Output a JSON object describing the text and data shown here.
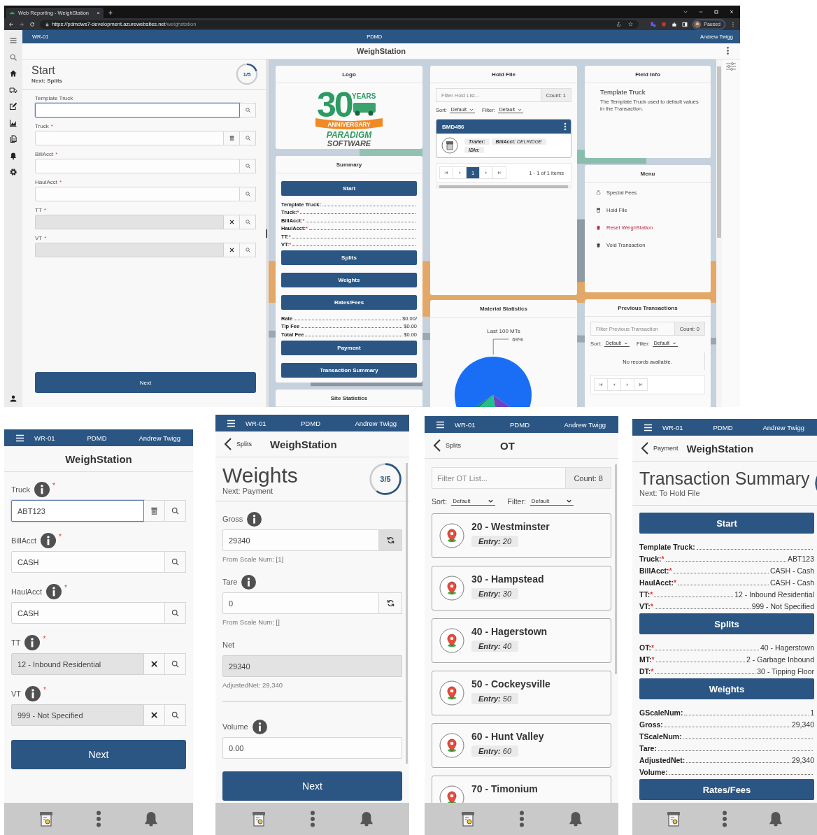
{
  "browser": {
    "tab_title": "Web Reporting - WeighStation",
    "tab_close": "×",
    "new_tab": "+",
    "url_host": "https://pdmdws7-development.azurewebsites.net",
    "url_path": "/weighstation",
    "profile_status": "Paused"
  },
  "desktop": {
    "header": {
      "station": "WR-01",
      "site": "PDMD",
      "user": "Andrew Twigg"
    },
    "title": "WeighStation",
    "step": {
      "title": "Start",
      "next": "Next: Splits",
      "progress": "1/5"
    },
    "fields": [
      {
        "label": "Template Truck",
        "focused": true,
        "disabled": false,
        "actions": [
          {
            "kind": "search"
          }
        ]
      },
      {
        "label": "Truck",
        "required_mark": "*",
        "focused": false,
        "disabled": false,
        "actions": [
          {
            "kind": "hold"
          },
          {
            "kind": "search"
          }
        ]
      },
      {
        "label": "BillAcct",
        "required_mark": "*",
        "focused": false,
        "disabled": false,
        "actions": [
          {
            "kind": "search"
          }
        ]
      },
      {
        "label": "HaulAcct",
        "required_mark": "*",
        "focused": false,
        "disabled": false,
        "actions": [
          {
            "kind": "search"
          }
        ]
      },
      {
        "label": "TT",
        "required_mark": "*",
        "focused": false,
        "disabled": true,
        "actions": [
          {
            "kind": "clear"
          },
          {
            "kind": "search"
          }
        ]
      },
      {
        "label": "VT",
        "required_mark": "*",
        "focused": false,
        "disabled": true,
        "actions": [
          {
            "kind": "clear"
          },
          {
            "kind": "search"
          }
        ]
      }
    ],
    "next_button": "Next",
    "columns": [
      [
        {
          "kind": "logo",
          "title": "Logo",
          "logo": {
            "number": "30",
            "badge": "YEARS",
            "ribbon": "ANNIVERSARY",
            "name": "PARADIGM",
            "tagline": "SOFTWARE"
          }
        },
        {
          "kind": "summary",
          "title": "Summary",
          "items": [
            {
              "kind": "button",
              "label": "Start"
            },
            {
              "kind": "row",
              "label": "Template Truck:"
            },
            {
              "kind": "row",
              "label": "Truck:",
              "mark": "*"
            },
            {
              "kind": "row",
              "label": "BillAcct:",
              "mark": "*"
            },
            {
              "kind": "row",
              "label": "HaulAcct:",
              "mark": "*"
            },
            {
              "kind": "row",
              "label": "TT:",
              "mark": "*"
            },
            {
              "kind": "row",
              "label": "VT:",
              "mark": "*"
            },
            {
              "kind": "button",
              "label": "Splits"
            },
            {
              "kind": "button",
              "label": "Weights"
            },
            {
              "kind": "button",
              "label": "Rates/Fees"
            },
            {
              "kind": "row",
              "label": "Rate",
              "value": "$0.00/"
            },
            {
              "kind": "row",
              "label": "Tip Fee",
              "value": "$0.00"
            },
            {
              "kind": "row",
              "label": "Total Fee",
              "value": "$0.00"
            },
            {
              "kind": "button",
              "label": "Payment"
            },
            {
              "kind": "button",
              "label": "Transaction Summary"
            }
          ]
        },
        {
          "kind": "plain",
          "title": "Site Statistics"
        }
      ],
      [
        {
          "kind": "hold_file",
          "title": "Hold File",
          "filter_placeholder": "Filter Hold List...",
          "count": "Count: 1",
          "sort_label": "Sort:",
          "sort_value": "Default",
          "filter_label": "Filter:",
          "filter_value": "Default",
          "cards": [
            {
              "name": "BMD456",
              "tags": [
                {
                  "label": "Trailer:"
                },
                {
                  "label": "BillAcct:",
                  "value": "DELRIDGE"
                },
                {
                  "label": "IDIn:"
                }
              ]
            }
          ],
          "pages": [
            {
              "label": "1",
              "selected": true
            }
          ],
          "pager_summary": "1 - 1 of 1 items"
        },
        {
          "kind": "material_stats",
          "title": "Material Statistics",
          "chart_data": {
            "type": "pie",
            "title": "Last 100 MTs",
            "values": [
              69,
              13,
              16,
              2
            ],
            "colors": [
              "#1a6ef5",
              "#6f42c1",
              "#20c08a",
              "#198754"
            ],
            "value_labels": [
              "69%",
              null,
              null,
              null
            ]
          }
        }
      ],
      [
        {
          "kind": "field_info",
          "title": "Field Info",
          "heading": "Template Truck",
          "text": "The Template Truck used to default values in the Transaction."
        },
        {
          "kind": "menu",
          "title": "Menu",
          "items": [
            {
              "kind": "fees",
              "label": "Special Fees",
              "danger": false
            },
            {
              "kind": "hold",
              "label": "Hold File",
              "danger": false
            },
            {
              "kind": "trash",
              "label": "Reset WeighStation",
              "danger": true
            },
            {
              "kind": "trash",
              "label": "Void Transaction",
              "danger": false
            }
          ]
        },
        {
          "kind": "previous_transactions",
          "title": "Previous Transactions",
          "filter_placeholder": "Filter Previous Transaction",
          "count": "Count: 0",
          "sort_label": "Sort:",
          "sort_value": "Default",
          "filter_label": "Filter:",
          "filter_value": "Default",
          "empty_text": "No records available."
        }
      ]
    ]
  },
  "phones": [
    {
      "kind": "form",
      "header": {
        "station": "WR-01",
        "site": "PDMD",
        "user": "Andrew Twigg"
      },
      "title": "WeighStation",
      "fields": [
        {
          "kind": "field",
          "label": "Truck",
          "info": true,
          "required_mark": "*",
          "value": "ABT123",
          "focused": true,
          "disabled": false,
          "actions": [
            {
              "kind": "hold"
            },
            {
              "kind": "search"
            }
          ]
        },
        {
          "kind": "field",
          "label": "BillAcct",
          "info": true,
          "required_mark": "*",
          "value": "CASH",
          "focused": false,
          "disabled": false,
          "actions": [
            {
              "kind": "search"
            }
          ]
        },
        {
          "kind": "field",
          "label": "HaulAcct",
          "info": true,
          "required_mark": "*",
          "value": "CASH",
          "focused": false,
          "disabled": false,
          "actions": [
            {
              "kind": "search"
            }
          ]
        },
        {
          "kind": "field",
          "label": "TT",
          "info": true,
          "required_mark": "*",
          "value": "12 - Inbound Residential",
          "focused": false,
          "disabled": true,
          "actions": [
            {
              "kind": "clear"
            },
            {
              "kind": "search"
            }
          ]
        },
        {
          "kind": "field",
          "label": "VT",
          "info": true,
          "required_mark": "*",
          "value": "999 - Not Specified",
          "focused": false,
          "disabled": true,
          "actions": [
            {
              "kind": "clear"
            },
            {
              "kind": "search"
            }
          ]
        }
      ],
      "next_button": "Next"
    },
    {
      "kind": "weights",
      "header": {
        "station": "WR-01",
        "site": "PDMD",
        "user": "Andrew Twigg"
      },
      "back": "Splits",
      "title": "WeighStation",
      "step": {
        "title": "Weights",
        "next": "Next: Payment",
        "progress": "3/5"
      },
      "fields": [
        {
          "kind": "field",
          "label": "Gross",
          "info": true,
          "value": "29340",
          "focused": false,
          "disabled": false,
          "actions": [
            {
              "kind": "refresh",
              "pressed": true
            }
          ],
          "note": "From Scale Num: [1]"
        },
        {
          "kind": "field",
          "label": "Tare",
          "info": true,
          "value": "0",
          "focused": false,
          "disabled": false,
          "actions": [
            {
              "kind": "refresh",
              "pressed": false
            }
          ],
          "note": "From Scale Num: []"
        },
        {
          "kind": "field",
          "label": "Net",
          "info": false,
          "value": "29340",
          "focused": false,
          "disabled": true,
          "note": "AdjustedNet: 29,340"
        },
        {
          "kind": "divider"
        },
        {
          "kind": "field",
          "label": "Volume",
          "info": true,
          "value": "0.00",
          "focused": false,
          "disabled": false
        }
      ],
      "next_button": "Next"
    },
    {
      "kind": "list",
      "header": {
        "station": "WR-01",
        "site": "PDMD",
        "user": "Andrew Twigg"
      },
      "back": "Splits",
      "title": "OT",
      "filter_placeholder": "Filter OT List...",
      "count": "Count: 8",
      "sort_label": "Sort:",
      "sort_value": "Default",
      "filter_label": "Filter:",
      "filter_value": "Default",
      "cards": [
        {
          "name": "20 - Westminster",
          "entry_label": "Entry:",
          "entry_value": "20"
        },
        {
          "name": "30 - Hampstead",
          "entry_label": "Entry:",
          "entry_value": "30"
        },
        {
          "name": "40 - Hagerstown",
          "entry_label": "Entry:",
          "entry_value": "40"
        },
        {
          "name": "50 - Cockeysville",
          "entry_label": "Entry:",
          "entry_value": "50"
        },
        {
          "name": "60 - Hunt Valley",
          "entry_label": "Entry:",
          "entry_value": "60"
        },
        {
          "name": "70 - Timonium"
        }
      ]
    },
    {
      "kind": "summary",
      "header": {
        "station": "WR-01",
        "site": "PDMD",
        "user": "Andrew Twigg"
      },
      "back": "Payment",
      "title": "WeighStation",
      "step": {
        "title": "Transaction Summary",
        "next": "Next: To Hold File"
      },
      "items": [
        {
          "kind": "button",
          "label": "Start"
        },
        {
          "kind": "row",
          "label": "Template Truck:"
        },
        {
          "kind": "row",
          "label": "Truck:",
          "mark": "*",
          "value": "ABT123"
        },
        {
          "kind": "row",
          "label": "BillAcct:",
          "mark": "*",
          "value": "CASH - Cash"
        },
        {
          "kind": "row",
          "label": "HaulAcct:",
          "mark": "*",
          "value": "CASH - Cash"
        },
        {
          "kind": "row",
          "label": "TT:",
          "mark": "*",
          "value": "12 - Inbound Residential"
        },
        {
          "kind": "row",
          "label": "VT:",
          "mark": "*",
          "value": "999 - Not Specified"
        },
        {
          "kind": "button",
          "label": "Splits"
        },
        {
          "kind": "row",
          "label": "OT:",
          "mark": "*",
          "value": "40 - Hagerstown"
        },
        {
          "kind": "row",
          "label": "MT:",
          "mark": "*",
          "value": "2 - Garbage Inbound"
        },
        {
          "kind": "row",
          "label": "DT:",
          "mark": "*",
          "value": "30 - Tipping Floor"
        },
        {
          "kind": "button",
          "label": "Weights"
        },
        {
          "kind": "row",
          "label": "GScaleNum:",
          "value": "1"
        },
        {
          "kind": "row",
          "label": "Gross:",
          "value": "29,340"
        },
        {
          "kind": "row",
          "label": "TScaleNum:"
        },
        {
          "kind": "row",
          "label": "Tare:"
        },
        {
          "kind": "row",
          "label": "AdjustedNet:",
          "value": "29,340"
        },
        {
          "kind": "row",
          "label": "Volume:"
        },
        {
          "kind": "button",
          "label": "Rates/Fees"
        }
      ]
    }
  ]
}
